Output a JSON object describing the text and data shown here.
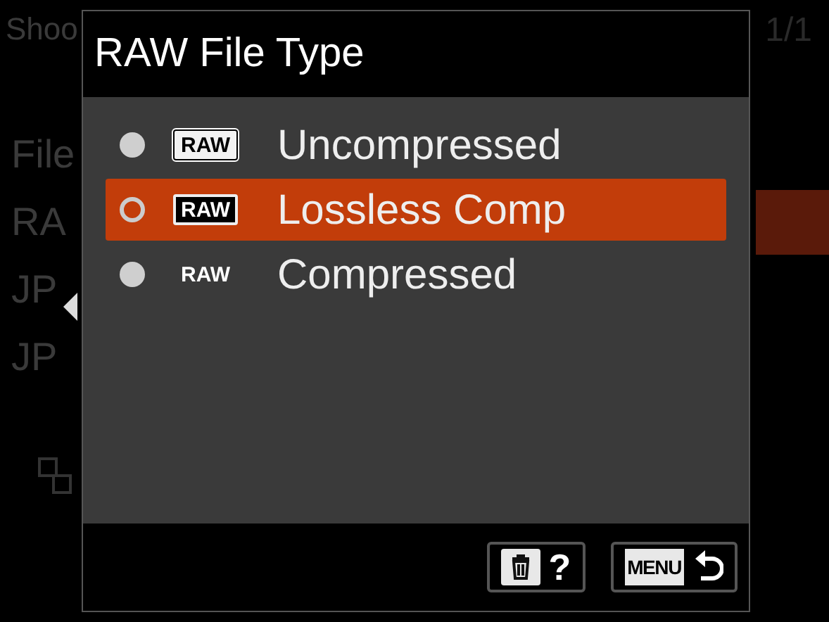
{
  "background": {
    "header": "Shoo",
    "page": "1/1",
    "items": [
      {
        "label": "File",
        "selected": false
      },
      {
        "label": "RA",
        "selected": true
      },
      {
        "label": "JP",
        "selected": false
      },
      {
        "label": "JP",
        "selected": false
      }
    ]
  },
  "dialog": {
    "title": "RAW File Type",
    "options": [
      {
        "label": "Uncompressed",
        "badge": "RAW",
        "kind": "boxed",
        "selected": false
      },
      {
        "label": "Lossless Comp",
        "badge": "RAW",
        "kind": "framed",
        "selected": true
      },
      {
        "label": "Compressed",
        "badge": "RAW",
        "kind": "plain",
        "selected": false
      }
    ],
    "footer": [
      {
        "kind": "delete",
        "text": "?"
      },
      {
        "kind": "back",
        "text": "MENU"
      }
    ]
  }
}
